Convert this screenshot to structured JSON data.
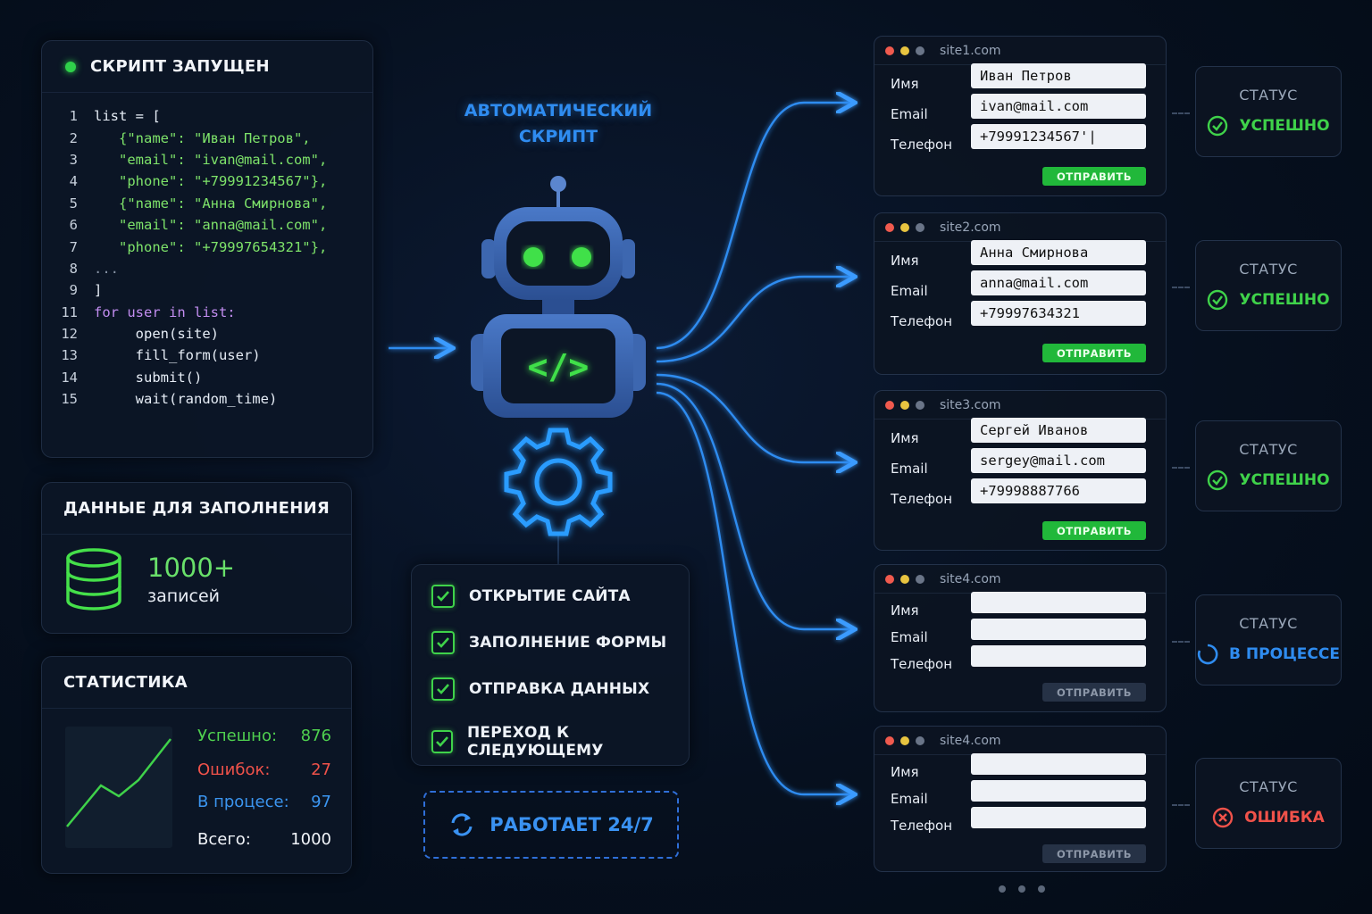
{
  "code_panel": {
    "title": "СКРИПТ ЗАПУЩЕН",
    "lines": [
      {
        "n": "1",
        "text": "list = ["
      },
      {
        "n": "2",
        "text": "   {\"name\": \"Иван Петров\","
      },
      {
        "n": "3",
        "text": "   \"email\": \"ivan@mail.com\","
      },
      {
        "n": "4",
        "text": "   \"phone\": \"+79991234567\"},"
      },
      {
        "n": "5",
        "text": "   {\"name\": \"Анна Смирнова\","
      },
      {
        "n": "6",
        "text": "   \"email\": \"anna@mail.com\","
      },
      {
        "n": "7",
        "text": "   \"phone\": \"+79997654321\"},"
      },
      {
        "n": "8",
        "text": "..."
      },
      {
        "n": "9",
        "text": "]"
      },
      {
        "n": "11",
        "text": "for user in list:"
      },
      {
        "n": "12",
        "text": "     open(site)"
      },
      {
        "n": "13",
        "text": "     fill_form(user)"
      },
      {
        "n": "14",
        "text": "     submit()"
      },
      {
        "n": "15",
        "text": "     wait(random_time)"
      }
    ]
  },
  "data_panel": {
    "title": "ДАННЫЕ ДЛЯ ЗАПОЛНЕНИЯ",
    "count": "1000+",
    "count_label": "записей"
  },
  "stats_panel": {
    "title": "СТАТИСТИКА",
    "rows": [
      {
        "label": "Успешно:",
        "value": "876",
        "color": "#4fd04f"
      },
      {
        "label": "Ошибок:",
        "value": "27",
        "color": "#f0524a"
      },
      {
        "label": "В процесе:",
        "value": "97",
        "color": "#3b95f0"
      },
      {
        "label": "Всего:",
        "value": "1000",
        "color": "#f2f5fa"
      }
    ]
  },
  "center": {
    "title_line1": "АВТОМАТИЧЕСКИЙ",
    "title_line2": "СКРИПТ",
    "code_glyph": "</>",
    "steps": [
      "ОТКРЫТИЕ САЙТА",
      "ЗАПОЛНЕНИЕ ФОРМЫ",
      "ОТПРАВКА ДАННЫХ",
      "ПЕРЕХОД К СЛЕДУЮЩЕМУ"
    ],
    "work_label": "РАБОТАЕТ 24/7"
  },
  "form_labels": {
    "name": "Имя",
    "email": "Email",
    "phone": "Телефон"
  },
  "sites": [
    {
      "url": "site1.com",
      "name": "Иван Петров",
      "email": "ivan@mail.com",
      "phone": "+79991234567'|",
      "button": "ОТПРАВИТЬ",
      "active": true
    },
    {
      "url": "site2.com",
      "name": "Анна Смирнова",
      "email": "anna@mail.com",
      "phone": "+79997634321",
      "button": "ОТПРАВИТЬ",
      "active": true
    },
    {
      "url": "site3.com",
      "name": "Сергей Иванов",
      "email": "sergey@mail.com",
      "phone": "+79998887766",
      "button": "ОТПРАВИТЬ",
      "active": true
    },
    {
      "url": "site4.com",
      "name": "",
      "email": "",
      "phone": "",
      "button": "ОТПРАВИТЬ",
      "active": false
    },
    {
      "url": "site4.com",
      "name": "",
      "email": "",
      "phone": "",
      "button": "ОТПРАВИТЬ",
      "active": false
    }
  ],
  "statuses": [
    {
      "label": "СТАТУС",
      "value": "УСПЕШНО",
      "icon": "check-circle-icon",
      "color": "#3fd24a"
    },
    {
      "label": "СТАТУС",
      "value": "УСПЕШНО",
      "icon": "check-circle-icon",
      "color": "#3fd24a"
    },
    {
      "label": "СТАТУС",
      "value": "УСПЕШНО",
      "icon": "check-circle-icon",
      "color": "#3fd24a"
    },
    {
      "label": "СТАТУС",
      "value": "В ПРОЦЕССЕ",
      "icon": "spinner-icon",
      "color": "#2f8cf0"
    },
    {
      "label": "СТАТУС",
      "value": "ОШИБКА",
      "icon": "x-circle-icon",
      "color": "#f0524a"
    }
  ],
  "colors": {
    "accent_blue": "#2f8cf0",
    "accent_green": "#3fd24a",
    "error_red": "#f0524a"
  }
}
